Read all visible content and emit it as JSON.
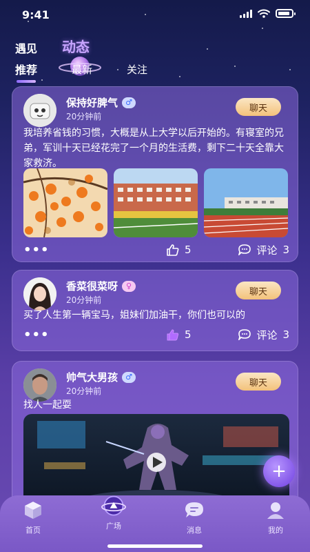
{
  "status_bar": {
    "time": "9:41"
  },
  "top_tabs": [
    {
      "label": "遇见",
      "active": false
    },
    {
      "label": "动态",
      "active": true
    }
  ],
  "sub_tabs": [
    {
      "label": "推荐",
      "active": true
    },
    {
      "label": "最新",
      "active": false
    },
    {
      "label": "关注",
      "active": false
    }
  ],
  "posts": [
    {
      "username": "保持好脾气",
      "gender": "male",
      "gender_icon": "male-icon",
      "time": "20分钟前",
      "chat_label": "聊天",
      "text": "我培养省钱的习惯，大概是从上大学以后开始的。有寝室的兄弟，军训十天已经花完了一个月的生活费，剩下二十天全靠大家救济。",
      "photos": [
        "persimmon-tree-photo",
        "school-building-photo",
        "running-track-photo"
      ],
      "more_label": "•••",
      "likes": "5",
      "comment_label": "评论",
      "comments": "3"
    },
    {
      "username": "香菜很菜呀",
      "gender": "female",
      "gender_icon": "female-icon",
      "time": "20分钟前",
      "chat_label": "聊天",
      "text": "买了人生第一辆宝马，姐妹们加油干，你们也可以的",
      "more_label": "•••",
      "likes": "5",
      "comment_label": "评论",
      "comments": "3"
    },
    {
      "username": "帅气大男孩",
      "gender": "male",
      "gender_icon": "male-icon",
      "time": "20分钟前",
      "chat_label": "聊天",
      "text": "找人一起耍",
      "video": "cyber-warrior-video"
    }
  ],
  "fab_label": "+",
  "bottom_nav": [
    {
      "label": "首页",
      "icon": "home-box-icon",
      "active": false
    },
    {
      "label": "广场",
      "icon": "planet-square-icon",
      "active": true
    },
    {
      "label": "消息",
      "icon": "message-bubble-icon",
      "active": false
    },
    {
      "label": "我的",
      "icon": "profile-icon",
      "active": false
    }
  ],
  "colors": {
    "accent": "#c7a4ff",
    "card": "#8c69dc",
    "chat_button": "#f3c27b",
    "nav_bar": "#8e6cd4"
  }
}
